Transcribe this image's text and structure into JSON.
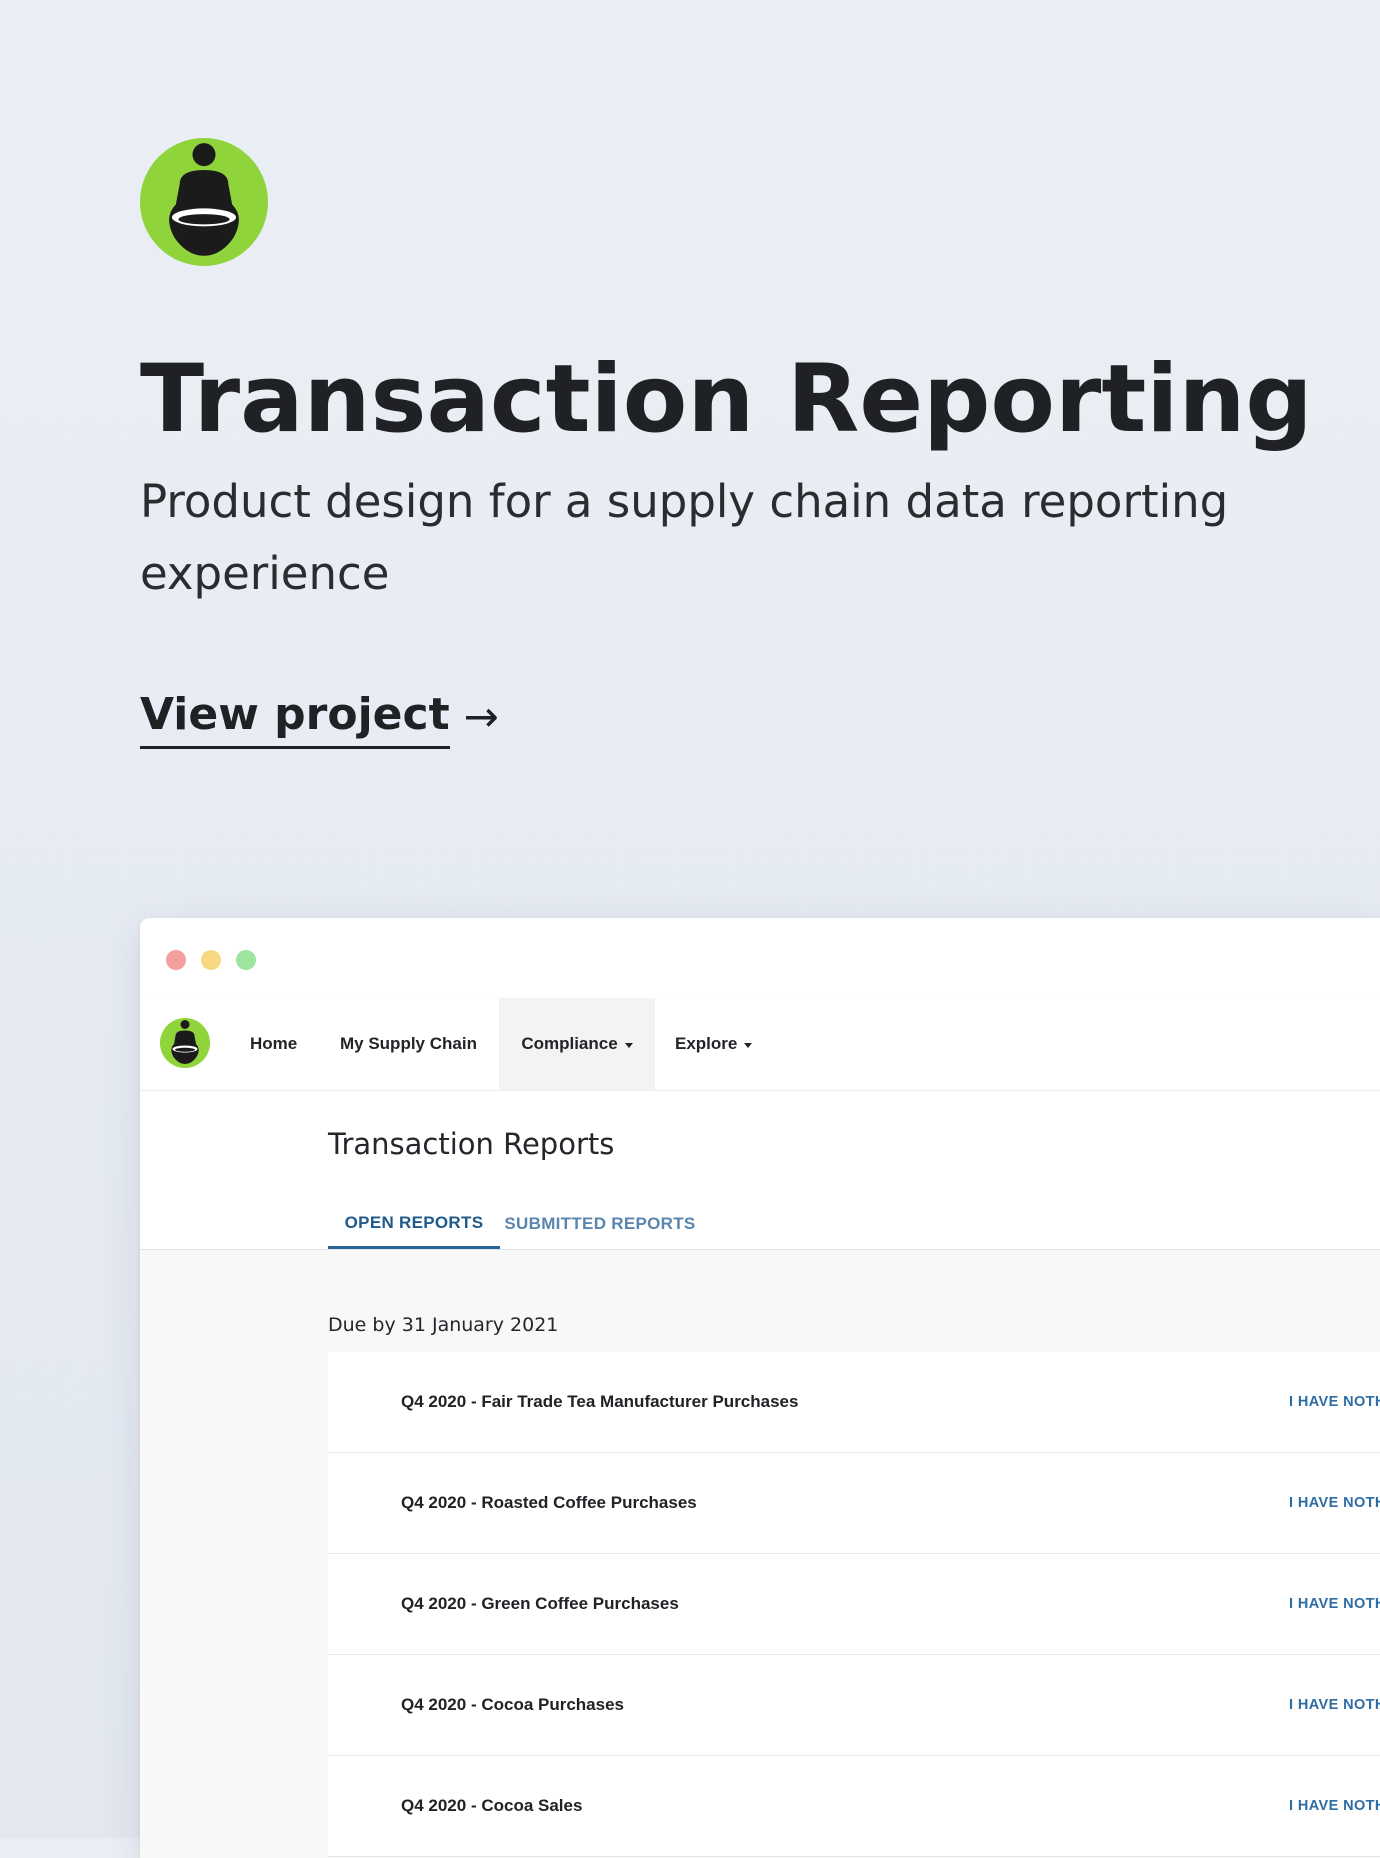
{
  "hero": {
    "title": "Transaction Reporting",
    "subtitle": "Product design for a supply chain data reporting experience",
    "link_label": "View project",
    "link_arrow": "→",
    "logo_icon": "person-with-basket-logo",
    "accent_color": "#8ed43a"
  },
  "app": {
    "nav": {
      "items": [
        {
          "label": "Home"
        },
        {
          "label": "My Supply Chain"
        },
        {
          "label": "Compliance"
        },
        {
          "label": "Explore"
        }
      ]
    },
    "page_title": "Transaction Reports",
    "tabs": [
      {
        "label": "OPEN REPORTS",
        "active": true
      },
      {
        "label": "SUBMITTED REPORTS",
        "active": false
      }
    ],
    "due_label": "Due by 31 January 2021",
    "reports": [
      {
        "name": "Q4 2020 - Fair Trade Tea Manufacturer Purchases",
        "action": "I HAVE NOTH"
      },
      {
        "name": "Q4 2020 - Roasted Coffee Purchases",
        "action": "I HAVE NOTH"
      },
      {
        "name": "Q4 2020 - Green Coffee Purchases",
        "action": "I HAVE NOTH"
      },
      {
        "name": "Q4 2020 - Cocoa Purchases",
        "action": "I HAVE NOTH"
      },
      {
        "name": "Q4 2020 - Cocoa Sales",
        "action": "I HAVE NOTH"
      }
    ]
  }
}
